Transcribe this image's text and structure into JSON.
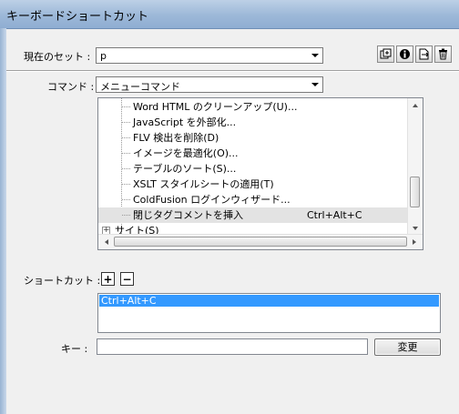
{
  "window": {
    "title": "キーボードショートカット"
  },
  "current_set": {
    "label": "現在のセット :",
    "value": "p"
  },
  "toolbar_icons": [
    "duplicate-set-icon",
    "info-icon",
    "export-icon",
    "delete-icon"
  ],
  "command": {
    "label": "コマンド :",
    "value": "メニューコマンド"
  },
  "tree": {
    "items": [
      {
        "label": "Word HTML のクリーンアップ(U)...",
        "shortcut": ""
      },
      {
        "label": "JavaScript を外部化...",
        "shortcut": ""
      },
      {
        "label": "FLV 検出を削除(D)",
        "shortcut": ""
      },
      {
        "label": "イメージを最適化(O)...",
        "shortcut": ""
      },
      {
        "label": "テーブルのソート(S)...",
        "shortcut": ""
      },
      {
        "label": "XSLT スタイルシートの適用(T)",
        "shortcut": ""
      },
      {
        "label": "ColdFusion ログインウィザード...",
        "shortcut": ""
      },
      {
        "label": "閉じタグコメントを挿入",
        "shortcut": "Ctrl+Alt+C"
      }
    ],
    "group": {
      "label": "サイト(S)"
    }
  },
  "shortcut": {
    "label": "ショートカット :",
    "add": "+",
    "remove": "−",
    "items": [
      "Ctrl+Alt+C"
    ]
  },
  "key": {
    "label": "キー :",
    "value": ""
  },
  "change_button": {
    "label": "変更"
  }
}
